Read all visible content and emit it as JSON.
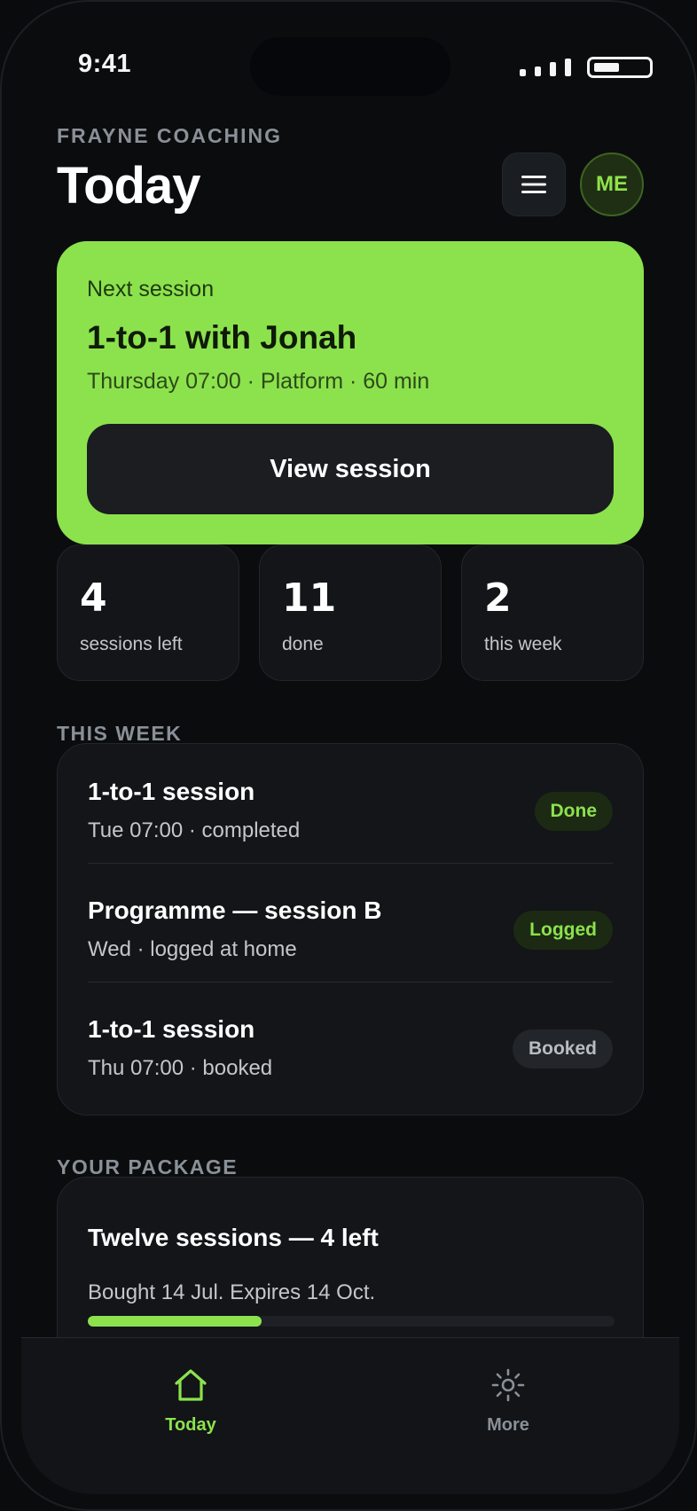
{
  "status": {
    "time": "9:41"
  },
  "header": {
    "brand": "FRAYNE COACHING",
    "title": "Today",
    "avatar_initials": "ME"
  },
  "next_session": {
    "eyebrow": "Next session",
    "title": "1-to-1 with Jonah",
    "meta": "Thursday 07:00 · Platform · 60 min",
    "button_label": "View session"
  },
  "stats": [
    {
      "value": "4",
      "label": "sessions left"
    },
    {
      "value": "11",
      "label": "done"
    },
    {
      "value": "2",
      "label": "this week"
    }
  ],
  "this_week": {
    "label": "THIS WEEK",
    "items": [
      {
        "title": "1-to-1 session",
        "subtitle": "Tue 07:00 · completed",
        "badge": "Done"
      },
      {
        "title": "Programme — session B",
        "subtitle": "Wed · logged at home",
        "badge": "Logged"
      },
      {
        "title": "1-to-1 session",
        "subtitle": "Thu 07:00 · booked",
        "badge": "Booked"
      }
    ]
  },
  "package": {
    "label": "YOUR PACKAGE",
    "title": "Twelve sessions — 4 left",
    "subtitle": "Bought 14 Jul. Expires 14 Oct.",
    "progress": 0.33
  },
  "tabs": [
    {
      "label": "Today",
      "icon": "home-icon",
      "active": true
    },
    {
      "label": "More",
      "icon": "sun-settings-icon",
      "active": false
    }
  ],
  "colors": {
    "accent": "#8ce24d",
    "background": "#0b0c0e",
    "surface": "#131518",
    "muted": "#8a9098"
  }
}
